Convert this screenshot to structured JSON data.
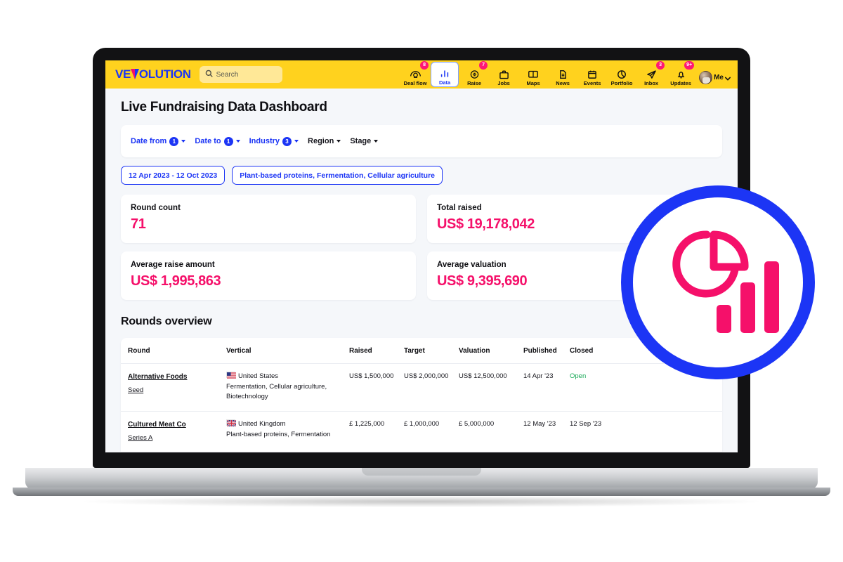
{
  "brand": {
    "logo_text_before": "VE",
    "logo_text_after": "OLUTION",
    "accent_blue": "#1C35F5",
    "accent_pink": "#F5106A",
    "bar_yellow": "#FFD21E"
  },
  "search": {
    "placeholder": "Search",
    "icon": "search-icon"
  },
  "nav": {
    "items": [
      {
        "label": "Deal flow",
        "icon": "dealflow-icon",
        "badge": "8",
        "active": false
      },
      {
        "label": "Data",
        "icon": "bar-chart-icon",
        "badge": "",
        "active": true
      },
      {
        "label": "Raise",
        "icon": "raise-money-icon",
        "badge": "7",
        "active": false
      },
      {
        "label": "Jobs",
        "icon": "briefcase-icon",
        "badge": "",
        "active": false
      },
      {
        "label": "Maps",
        "icon": "open-book-icon",
        "badge": "",
        "active": false
      },
      {
        "label": "News",
        "icon": "document-icon",
        "badge": "",
        "active": false
      },
      {
        "label": "Events",
        "icon": "calendar-icon",
        "badge": "",
        "active": false
      },
      {
        "label": "Portfolio",
        "icon": "pie-chart-icon",
        "badge": "",
        "active": false
      },
      {
        "label": "Inbox",
        "icon": "paper-plane-icon",
        "badge": "3",
        "active": false
      },
      {
        "label": "Updates",
        "icon": "bell-icon",
        "badge": "9+",
        "active": false
      }
    ],
    "account": {
      "label": "Me",
      "icon": "avatar",
      "chevron": "chevron-down-icon"
    }
  },
  "page": {
    "title": "Live Fundraising Data Dashboard"
  },
  "filters": [
    {
      "label": "Date from",
      "count": "1",
      "style": "blue"
    },
    {
      "label": "Date to",
      "count": "1",
      "style": "blue"
    },
    {
      "label": "Industry",
      "count": "3",
      "style": "blue"
    },
    {
      "label": "Region",
      "count": "",
      "style": "dark"
    },
    {
      "label": "Stage",
      "count": "",
      "style": "dark"
    }
  ],
  "chips": [
    "12 Apr 2023 - 12 Oct 2023",
    "Plant-based proteins, Fermentation, Cellular agriculture"
  ],
  "stats": [
    {
      "label": "Round count",
      "value": "71"
    },
    {
      "label": "Total raised",
      "value": "US$ 19,178,042"
    },
    {
      "label": "Average raise amount",
      "value": "US$ 1,995,863"
    },
    {
      "label": "Average valuation",
      "value": "US$ 9,395,690"
    }
  ],
  "rounds": {
    "section_title": "Rounds overview",
    "columns": [
      "Round",
      "Vertical",
      "Raised",
      "Target",
      "Valuation",
      "Published",
      "Closed"
    ],
    "rows": [
      {
        "company": "Alternative Foods",
        "stage": "Seed",
        "country": "United States",
        "flag": "us-flag-icon",
        "verticals": "Fermentation, Cellular agriculture, Biotechnology",
        "raised": "US$ 1,500,000",
        "target": "US$ 2,000,000",
        "valuation": "US$ 12,500,000",
        "published": "14 Apr '23",
        "closed": "Open",
        "closed_open": true
      },
      {
        "company": "Cultured Meat Co",
        "stage": "Series A",
        "country": "United Kingdom",
        "flag": "uk-flag-icon",
        "verticals": "Plant-based proteins, Fermentation",
        "raised": "£ 1,225,000",
        "target": "£ 1,000,000",
        "valuation": "£ 5,000,000",
        "published": "12 May '23",
        "closed": "12 Sep '23",
        "closed_open": false
      }
    ]
  },
  "data_badge": {
    "icon": "pie-chart-bars-icon",
    "ring_color": "#1C35F5",
    "glyph_color": "#F5106A"
  }
}
